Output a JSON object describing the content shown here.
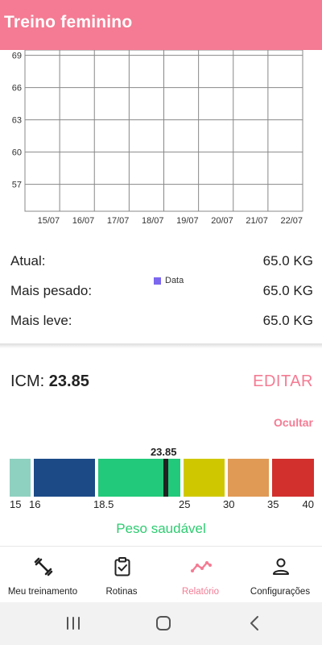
{
  "appbar": {
    "title": "Treino feminino"
  },
  "chart_data": {
    "type": "line",
    "x_tick_labels": [
      "15/07",
      "16/07",
      "17/07",
      "18/07",
      "19/07",
      "20/07",
      "21/07",
      "22/07"
    ],
    "y_tick_labels": [
      "57",
      "60",
      "63",
      "66",
      "69"
    ],
    "y_ticks": [
      57,
      60,
      63,
      66,
      69
    ],
    "ylim": [
      54.5,
      69.5
    ],
    "grid": true,
    "legend": {
      "position": "bottom",
      "entries": [
        "Data"
      ]
    },
    "series": [
      {
        "name": "Data",
        "color": "#7b68ee",
        "values": []
      }
    ]
  },
  "stats": {
    "current_label": "Atual:",
    "current_value": "65.0 KG",
    "heaviest_label": "Mais pesado:",
    "heaviest_value": "65.0 KG",
    "lightest_label": "Mais leve:",
    "lightest_value": "65.0 KG"
  },
  "bmi": {
    "label": "ICM: ",
    "value": "23.85",
    "value_number": 23.85,
    "edit_label": "EDITAR",
    "hide_label": "Ocultar",
    "status": "Peso saudável",
    "scale_ticks": [
      "15",
      "16",
      "18.5",
      "25",
      "30",
      "35",
      "40"
    ],
    "colors": {
      "very_severely_underweight": "#8fd1c0",
      "underweight": "#1b4a87",
      "normal": "#22c97a",
      "overweight": "#cfc800",
      "obese_1": "#e09a55",
      "obese_2": "#d2302d"
    }
  },
  "nav": {
    "items": [
      {
        "label": "Meu treinamento",
        "icon": "dumbbell-icon"
      },
      {
        "label": "Rotinas",
        "icon": "clipboard-check-icon"
      },
      {
        "label": "Relatório",
        "icon": "chart-line-icon"
      },
      {
        "label": "Configurações",
        "icon": "person-icon"
      }
    ]
  },
  "accent": "#f47b93"
}
